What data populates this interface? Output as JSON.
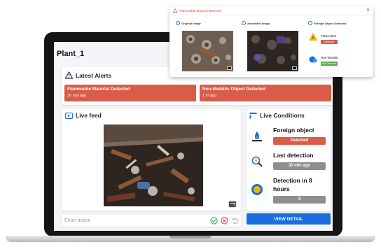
{
  "app": {
    "title": "Plant_1"
  },
  "alerts": {
    "heading": "Latest Alerts",
    "items": [
      {
        "title": "Flammable Material Detected",
        "time": "30 min ago"
      },
      {
        "title": "Non-Metallic Object Detected",
        "time": "1 hr ago"
      }
    ]
  },
  "feed": {
    "heading": "Live feed"
  },
  "conditions": {
    "heading": "Live Conditions",
    "rows": [
      {
        "label": "Foreign object",
        "value": "Detected",
        "status": "alert"
      },
      {
        "label": "Last detection",
        "value": "30 min ago",
        "status": "neutral"
      },
      {
        "label": "Detection in 8 hours",
        "value": "3",
        "status": "neutral"
      }
    ]
  },
  "action": {
    "placeholder": "Enter action"
  },
  "view_detail": {
    "label": "VIEW DETAIL"
  },
  "popup": {
    "title": "Flammable Material Detected",
    "columns": [
      "Original Image",
      "Annotated Image",
      "Foreign Object Detected"
    ],
    "objects": [
      {
        "label": "Flammable",
        "status": "Detected",
        "color": "#d85c48"
      },
      {
        "label": "Non-Metallic",
        "status": "Not Detected",
        "color": "#5aa84a"
      }
    ]
  },
  "colors": {
    "alert": "#d85c48",
    "accent": "#1a6ee0",
    "neutral": "#8d8d92",
    "ok": "#5aa84a"
  },
  "icons": [
    "warning-icon",
    "video-icon",
    "conditions-icon",
    "check-icon",
    "cancel-icon",
    "undo-icon",
    "expand-icon",
    "close-icon",
    "flame-icon",
    "magnifier-icon",
    "counter-icon"
  ]
}
